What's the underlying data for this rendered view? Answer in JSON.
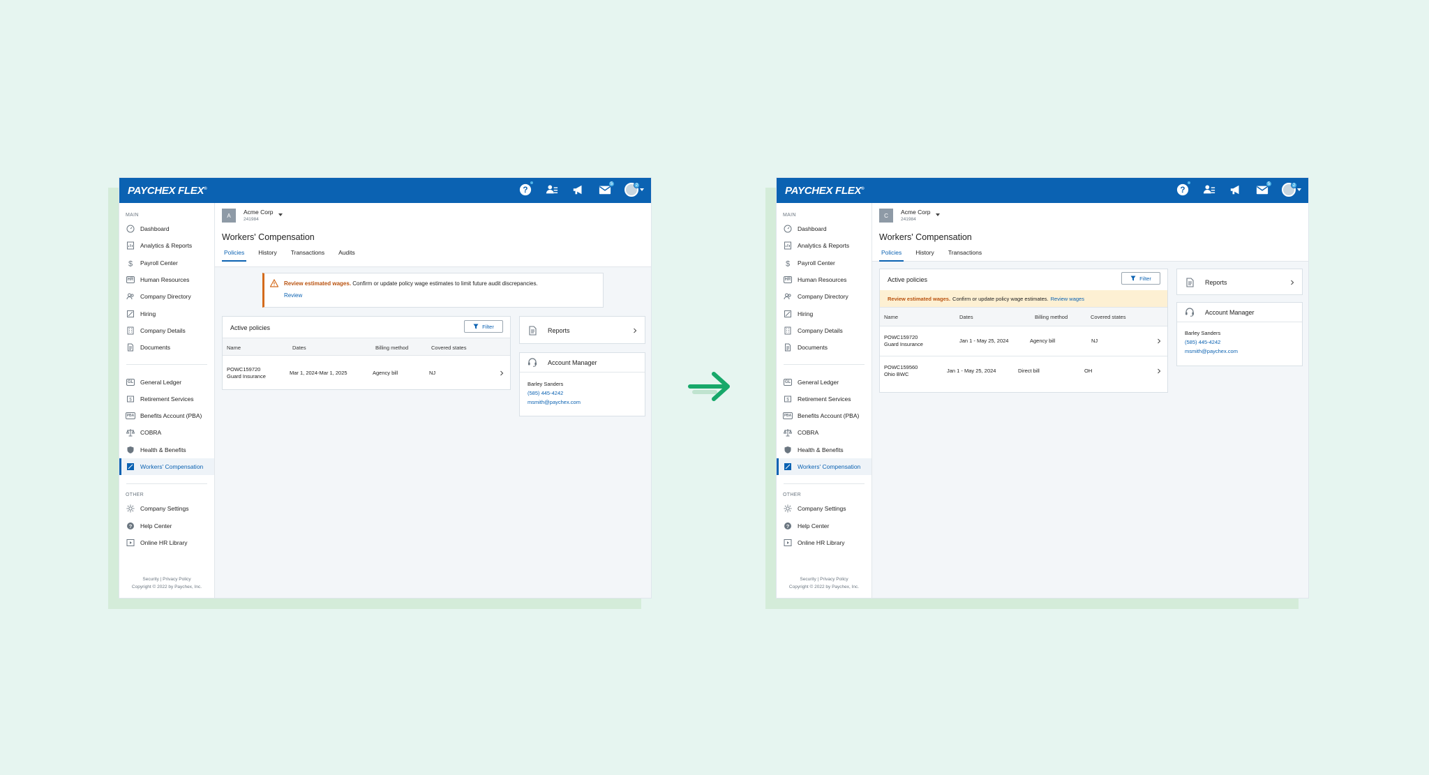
{
  "brand": {
    "logo": "PAYCHEX FLEX",
    "logo_mark": "®",
    "primary_color": "#0b62b2",
    "accent_arrow_color": "#17a86a"
  },
  "topbar_icons": [
    {
      "name": "help-icon",
      "badge": ""
    },
    {
      "name": "people-icon",
      "badge": ""
    },
    {
      "name": "megaphone-icon",
      "badge": ""
    },
    {
      "name": "mail-icon",
      "badge": "5"
    },
    {
      "name": "avatar",
      "badge": "2"
    }
  ],
  "sidebar": {
    "main_label": "MAIN",
    "main_items": [
      "Dashboard",
      "Analytics & Reports",
      "Payroll Center",
      "Human Resources",
      "Company Directory",
      "Hiring",
      "Company Details",
      "Documents"
    ],
    "apps_items": [
      "General Ledger",
      "Retirement Services",
      "Benefits Account (PBA)",
      "COBRA",
      "Health & Benefits",
      "Workers' Compensation"
    ],
    "other_label": "OTHER",
    "other_items": [
      "Company Settings",
      "Help Center",
      "Online HR Library"
    ],
    "hr_tag": "HR",
    "gl_tag": "GL",
    "pba_tag": "PBA",
    "footer_links": "Security  |  Privacy Policy",
    "copyright": "Copyright © 2022 by Paychex, Inc."
  },
  "before": {
    "company": {
      "avatar": "A",
      "name": "Acme Corp",
      "id": "241984"
    },
    "page_title": "Workers' Compensation",
    "tabs": [
      "Policies",
      "History",
      "Transactions",
      "Audits"
    ],
    "alert": {
      "bold": "Review estimated wages.",
      "text": " Confirm or update policy wage estimates to limit future audit discrepancies.",
      "link": "Review"
    },
    "policies": {
      "title": "Active policies",
      "filter": "Filter",
      "columns": [
        "Name",
        "Dates",
        "Billing method",
        "Covered states"
      ],
      "rows": [
        {
          "id": "POWC159720",
          "carrier": "Guard Insurance",
          "dates": "Mar 1, 2024-Mar 1, 2025",
          "billing": "Agency bill",
          "state": "NJ"
        }
      ]
    },
    "reports": "Reports",
    "account_manager": {
      "title": "Account Manager",
      "name": "Barley Sanders",
      "phone": "(585) 445-4242",
      "email": "msmith@paychex.com"
    }
  },
  "after": {
    "company": {
      "avatar": "C",
      "name": "Acme Corp",
      "id": "241984"
    },
    "page_title": "Workers' Compensation",
    "tabs": [
      "Policies",
      "History",
      "Transactions"
    ],
    "alert": {
      "bold": "Review estimated wages.",
      "text": " Confirm or update policy wage estimates. ",
      "link": "Review wages"
    },
    "policies": {
      "title": "Active policies",
      "filter": "Filter",
      "columns": [
        "Name",
        "Dates",
        "Billing method",
        "Covered states"
      ],
      "rows": [
        {
          "id": "POWC159720",
          "carrier": "Guard Insurance",
          "dates": "Jan 1 - May 25, 2024",
          "billing": "Agency bill",
          "state": "NJ"
        },
        {
          "id": "POWC159560",
          "carrier": "Ohio BWC",
          "dates": "Jan 1 - May 25, 2024",
          "billing": "Direct bill",
          "state": "OH"
        }
      ]
    },
    "reports": "Reports",
    "account_manager": {
      "title": "Account Manager",
      "name": "Barley Sanders",
      "phone": "(585) 445-4242",
      "email": "msmith@paychex.com"
    }
  }
}
